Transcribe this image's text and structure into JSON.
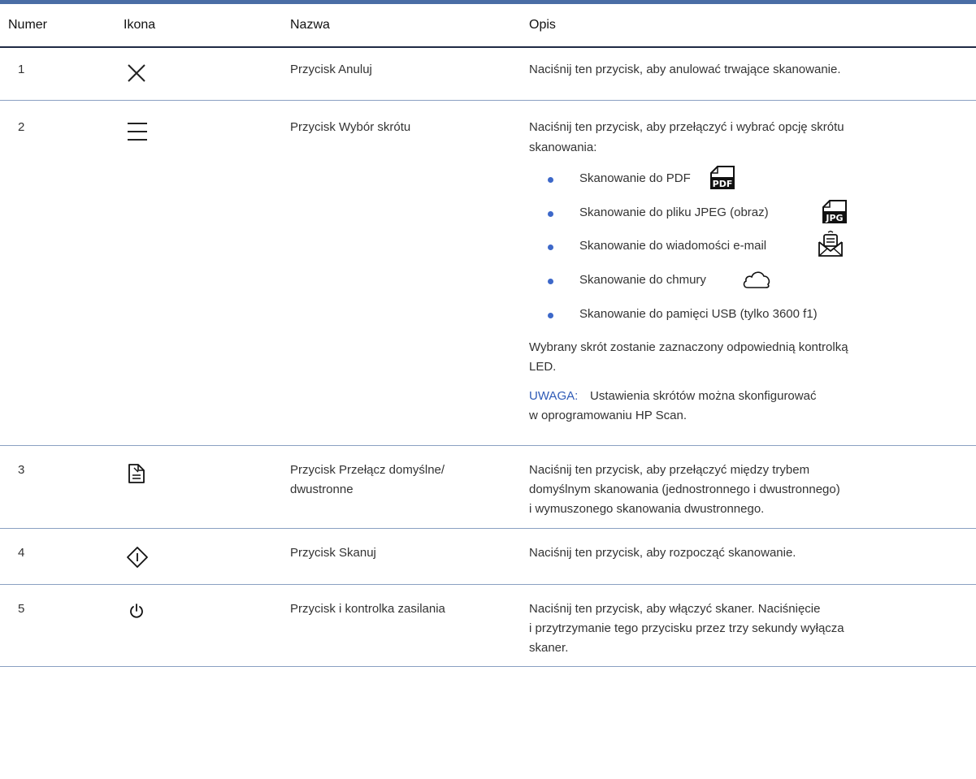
{
  "table": {
    "headers": {
      "numer": "Numer",
      "ikona": "Ikona",
      "nazwa": "Nazwa",
      "opis": "Opis"
    },
    "rows": [
      {
        "number": "1",
        "icon": "close-icon",
        "name": "Przycisk Anuluj",
        "desc": [
          "Naciśnij ten przycisk, aby anulować trwające skanowanie."
        ]
      },
      {
        "number": "2",
        "icon": "menu-icon",
        "name": "Przycisk Wybór skrótu",
        "desc": [
          "Naciśnij ten przycisk, aby przełączyć i wybrać opcję skrótu",
          "skanowania:"
        ],
        "bullets": [
          {
            "text": "Skanowanie do PDF",
            "icon": "pdf-file-icon",
            "icon_label": "PDF"
          },
          {
            "text": "Skanowanie do pliku JPEG (obraz)",
            "icon": "jpg-file-icon",
            "icon_label": "JPG"
          },
          {
            "text": "Skanowanie do wiadomości e-mail",
            "icon": "email-icon"
          },
          {
            "text": "Skanowanie do chmury",
            "icon": "cloud-icon"
          },
          {
            "text": "Skanowanie do pamięci USB (tylko 3600 f1)"
          }
        ],
        "after": [
          "Wybrany skrót zostanie zaznaczony odpowiednią kontrolką",
          "LED."
        ],
        "note_label": "UWAGA:",
        "note": [
          "Ustawienia skrótów można skonfigurować",
          "w oprogramowaniu HP Scan."
        ]
      },
      {
        "number": "3",
        "icon": "duplex-document-icon",
        "name": [
          "Przycisk Przełącz domyślne/",
          "dwustronne"
        ],
        "desc": [
          "Naciśnij ten przycisk, aby przełączyć między trybem",
          "domyślnym skanowania (jednostronnego i dwustronnego)",
          "i wymuszonego skanowania dwustronnego."
        ]
      },
      {
        "number": "4",
        "icon": "scan-start-icon",
        "name": "Przycisk Skanuj",
        "desc": [
          "Naciśnij ten przycisk, aby rozpocząć skanowanie."
        ]
      },
      {
        "number": "5",
        "icon": "power-icon",
        "name": "Przycisk i kontrolka zasilania",
        "desc": [
          "Naciśnij ten przycisk, aby włączyć skaner. Naciśnięcie",
          "i przytrzymanie tego przycisku przez trzy sekundy wyłącza",
          "skaner."
        ]
      }
    ]
  },
  "colors": {
    "accent": "#4a6da5",
    "bullet": "#3d68c9",
    "note_label": "#2f5bb7"
  }
}
